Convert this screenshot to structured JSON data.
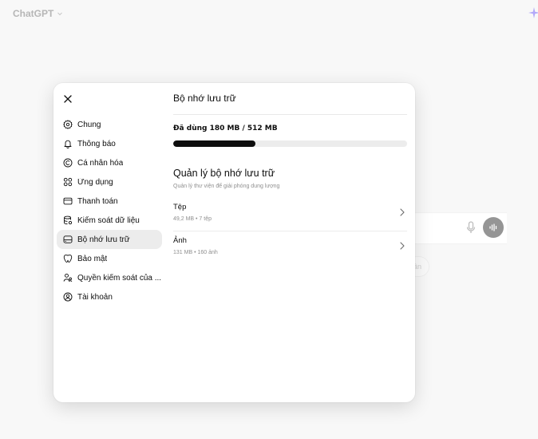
{
  "app": {
    "brand": "ChatGPT",
    "background_chip_text": "ần"
  },
  "settings": {
    "close_label": "Close",
    "nav": [
      {
        "label": "Chung",
        "icon": "gear-icon"
      },
      {
        "label": "Thông báo",
        "icon": "bell-icon"
      },
      {
        "label": "Cá nhân hóa",
        "icon": "personalize-icon"
      },
      {
        "label": "Ứng dụng",
        "icon": "apps-grid-icon"
      },
      {
        "label": "Thanh toán",
        "icon": "credit-card-icon"
      },
      {
        "label": "Kiểm soát dữ liệu",
        "icon": "data-controls-icon"
      },
      {
        "label": "Bộ nhớ lưu trữ",
        "icon": "storage-icon",
        "active": true
      },
      {
        "label": "Bảo mật",
        "icon": "security-icon"
      },
      {
        "label": "Quyền kiểm soát của ...",
        "icon": "parental-controls-icon"
      },
      {
        "label": "Tài khoản",
        "icon": "account-icon"
      }
    ],
    "storage": {
      "title": "Bộ nhớ lưu trữ",
      "usage_text": "Đã dùng 180 MB / 512 MB",
      "used_mb": 180,
      "total_mb": 512,
      "manage_title": "Quản lý bộ nhớ lưu trữ",
      "manage_subtitle": "Quản lý thư viện để giải phóng dung lượng",
      "rows": [
        {
          "title": "Tệp",
          "meta": "49,2 MB • 7 tệp"
        },
        {
          "title": "Ảnh",
          "meta": "131 MB • 160 ảnh"
        }
      ]
    }
  },
  "colors": {
    "bar_fill": "#0d0d0d",
    "bar_track": "#ececec",
    "active_nav": "#ececec",
    "accent_sparkle": "#8b7cf6"
  }
}
